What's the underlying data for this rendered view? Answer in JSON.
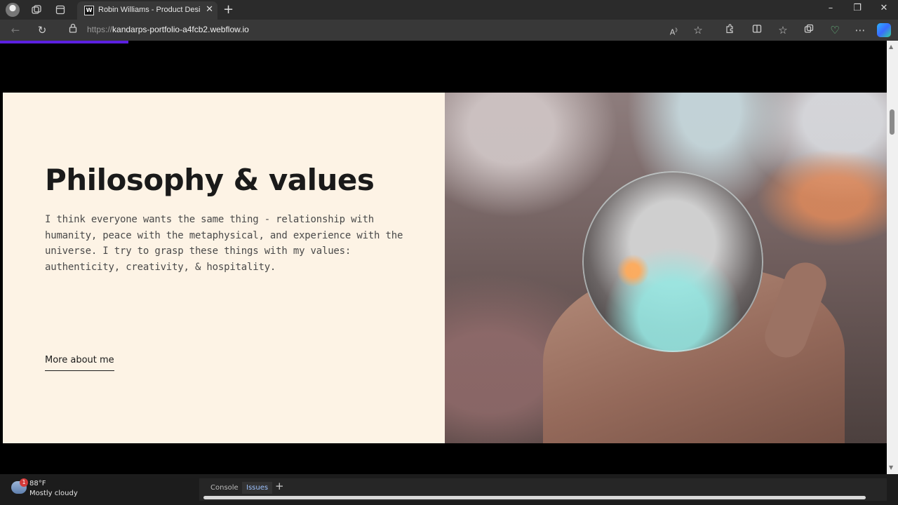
{
  "browser": {
    "tab_title": "Robin Williams - Product Designer",
    "tab_favicon": "W",
    "url_scheme": "https://",
    "url_host": "kandarps-portfolio-a4fcb2.webflow.io"
  },
  "page": {
    "heading": "Philosophy & values",
    "paragraph": "I think everyone wants the same thing - relationship with humanity, peace with the metaphysical, and experience with the universe. I try to grasp these things with my values: authenticity, creativity, & hospitality.",
    "link_label": "More about me",
    "scroll_progress": 0.145,
    "accent_color": "#5b1fe0"
  },
  "taskbar": {
    "weather_badge": "1",
    "temperature": "88°F",
    "condition": "Mostly cloudy"
  },
  "devtools": {
    "tabs": [
      "Console",
      "Issues"
    ],
    "active_tab": "Issues"
  }
}
